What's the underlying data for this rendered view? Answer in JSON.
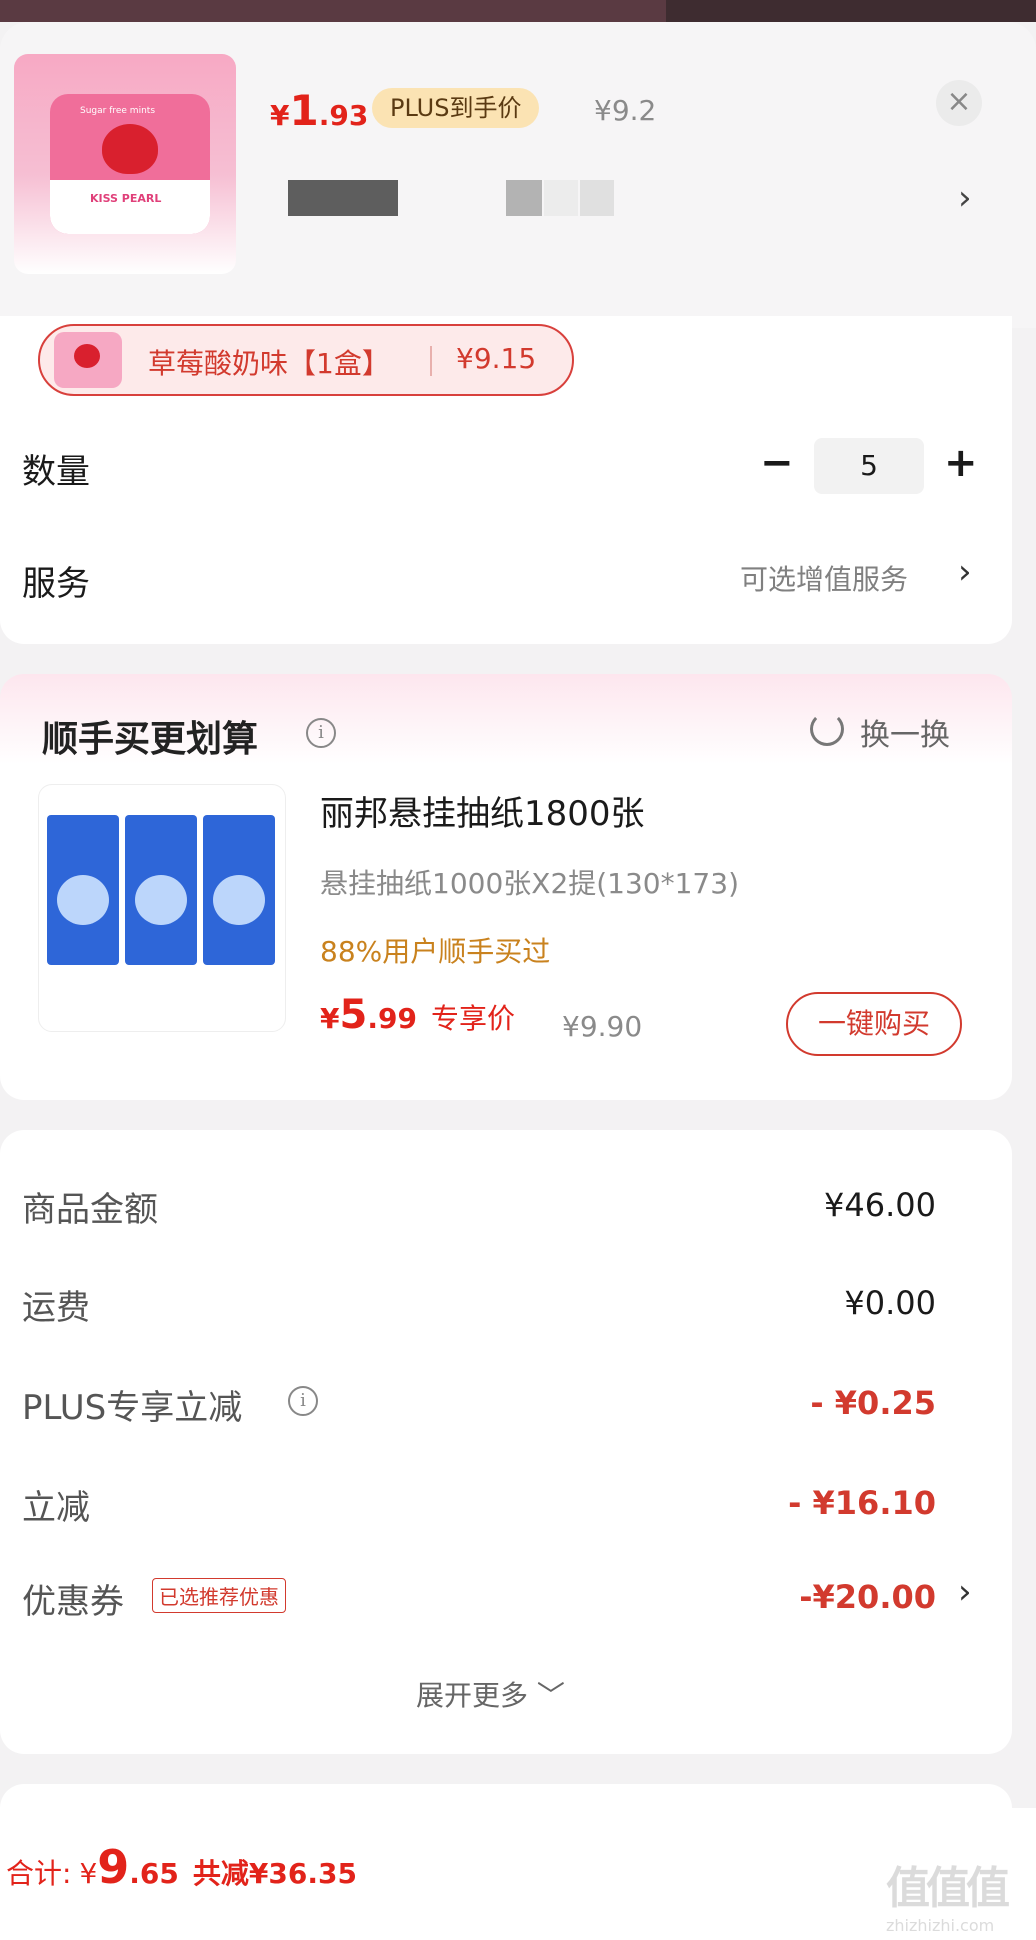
{
  "product": {
    "price_currency": "¥",
    "price_int": "1",
    "price_dec": ".93",
    "plus_tag": "PLUS到手价",
    "original_price": "¥9.2",
    "thumbnail_text": {
      "sub": "Sugar free mints",
      "brand": "KISS PEARL"
    }
  },
  "variant": {
    "name": "草莓酸奶味【1盒】",
    "price": "¥9.15"
  },
  "quantity": {
    "label": "数量",
    "minus": "−",
    "value": "5",
    "plus": "+"
  },
  "service": {
    "label": "服务",
    "value": "可选增值服务",
    "chevron": "›"
  },
  "recommend": {
    "title": "顺手买更划算",
    "refresh_label": "换一换",
    "item": {
      "name": "丽邦悬挂抽纸1800张",
      "spec": "悬挂抽纸1000张X2提(130*173)",
      "social_proof": "88%用户顺手买过",
      "price_currency": "¥",
      "price_int": "5",
      "price_dec": ".99",
      "exclusive_label": "专享价",
      "original_price": "¥9.90",
      "buy_label": "一键购买"
    }
  },
  "summary": {
    "rows": [
      {
        "label": "商品金额",
        "value": "¥46.00"
      },
      {
        "label": "运费",
        "value": "¥0.00"
      },
      {
        "label": "PLUS专享立减",
        "value": "- ¥0.25"
      },
      {
        "label": "立减",
        "value": "- ¥16.10"
      },
      {
        "label": "优惠券",
        "value": "-¥20.00"
      }
    ],
    "coupon_tag": "已选推荐优惠",
    "expand_label": "展开更多 ﹀"
  },
  "total": {
    "label": "合计:",
    "currency": "¥",
    "int": "9",
    "dec": ".65",
    "saved": "共减¥36.35"
  },
  "watermark": {
    "glyphs": "值值值",
    "url": "zhizhizhi.com"
  },
  "colors": {
    "accent_red": "#e2231a",
    "plus_tag_bg": "#fbe3b3",
    "social_orange": "#c9821e"
  },
  "icons": [
    "close-icon",
    "chevron-right-icon",
    "info-icon",
    "refresh-icon",
    "chevron-down-icon"
  ]
}
